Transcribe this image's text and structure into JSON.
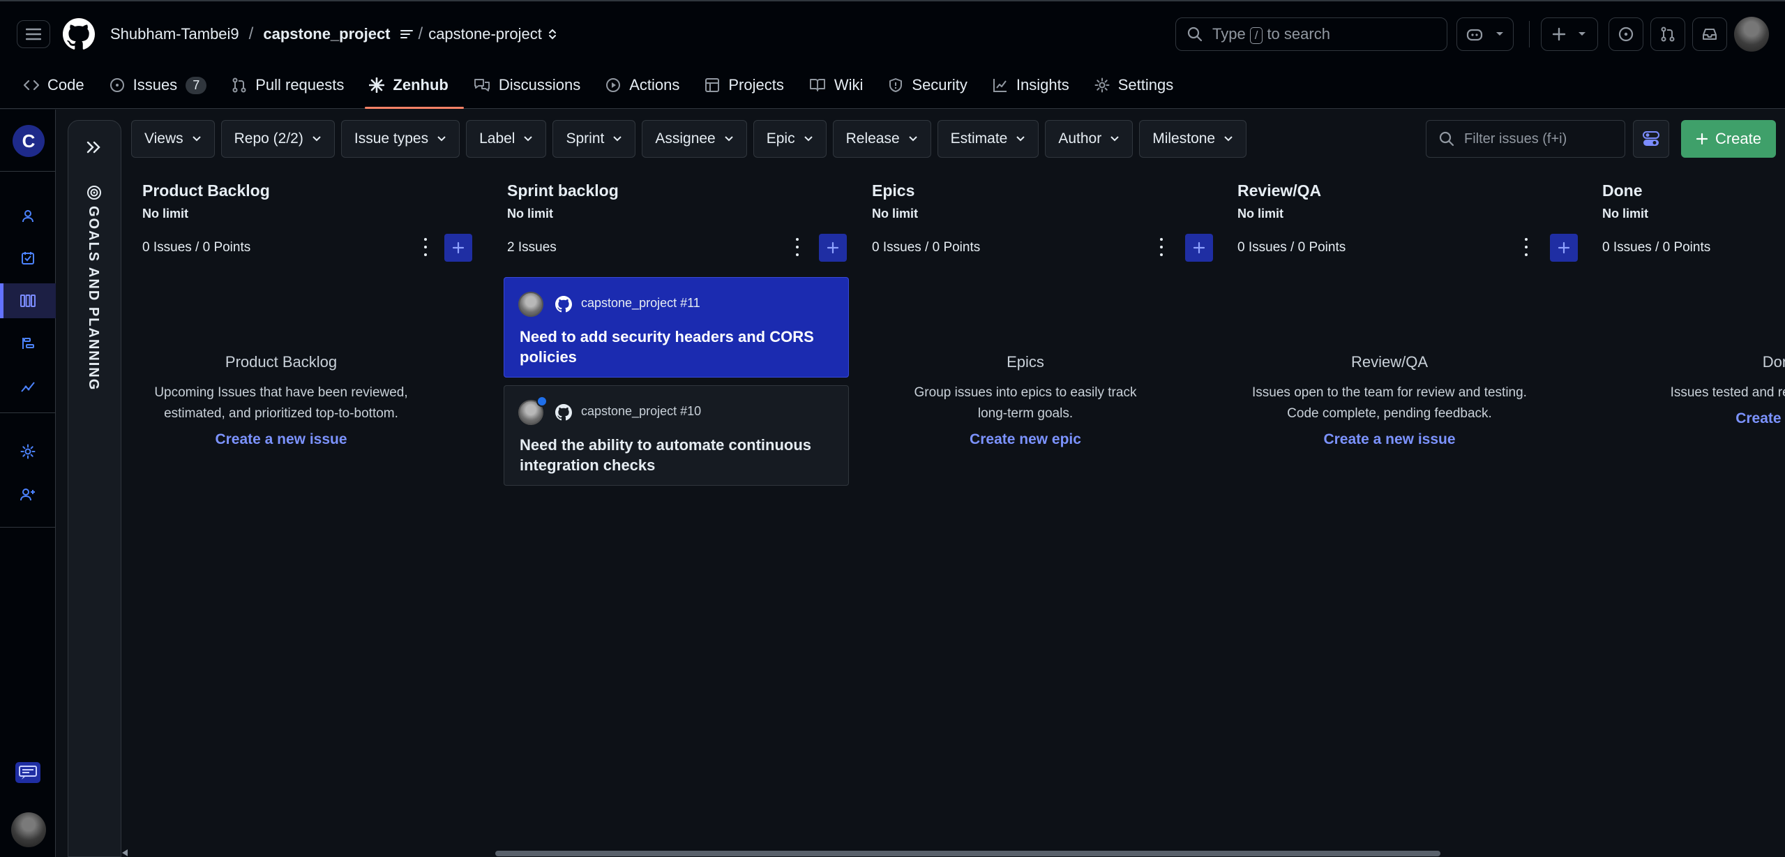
{
  "header": {
    "owner": "Shubham-Tambei9",
    "repo": "capstone_project",
    "project": "capstone-project",
    "search_prefix": "Type",
    "search_key": "/",
    "search_suffix": "to search"
  },
  "tabs": [
    {
      "label": "Code",
      "icon": "code-icon"
    },
    {
      "label": "Issues",
      "icon": "issue-opened-icon",
      "count": "7"
    },
    {
      "label": "Pull requests",
      "icon": "git-pull-request-icon"
    },
    {
      "label": "Zenhub",
      "icon": "zenhub-icon",
      "active": true
    },
    {
      "label": "Discussions",
      "icon": "comment-discussion-icon"
    },
    {
      "label": "Actions",
      "icon": "play-icon"
    },
    {
      "label": "Projects",
      "icon": "table-icon"
    },
    {
      "label": "Wiki",
      "icon": "book-icon"
    },
    {
      "label": "Security",
      "icon": "shield-icon"
    },
    {
      "label": "Insights",
      "icon": "graph-icon"
    },
    {
      "label": "Settings",
      "icon": "gear-icon"
    }
  ],
  "rail": {
    "logo_letter": "C"
  },
  "panel": {
    "title": "GOALS AND PLANNING"
  },
  "filters": [
    "Views",
    "Repo (2/2)",
    "Issue types",
    "Label",
    "Sprint",
    "Assignee",
    "Epic",
    "Release",
    "Estimate",
    "Author",
    "Milestone"
  ],
  "filter_input": {
    "placeholder": "Filter issues (f+i)"
  },
  "create_label": "Create",
  "columns": [
    {
      "title": "Product Backlog",
      "limit": "No limit",
      "count": "0 Issues / 0 Points",
      "empty_title": "Product Backlog",
      "empty_desc": "Upcoming Issues that have been reviewed, estimated, and prioritized top-to-bottom.",
      "empty_link": "Create a new issue"
    },
    {
      "title": "Sprint backlog",
      "limit": "No limit",
      "count": "2 Issues"
    },
    {
      "title": "Epics",
      "limit": "No limit",
      "count": "0 Issues / 0 Points",
      "empty_title": "Epics",
      "empty_desc": "Group issues into epics to easily track long-term goals.",
      "empty_link": "Create new epic"
    },
    {
      "title": "Review/QA",
      "limit": "No limit",
      "count": "0 Issues / 0 Points",
      "empty_title": "Review/QA",
      "empty_desc": "Issues open to the team for review and testing. Code complete, pending feedback.",
      "empty_link": "Create a new issue"
    },
    {
      "title": "Done",
      "limit": "No limit",
      "count": "0 Issues / 0 Points",
      "empty_title": "Done",
      "empty_desc": "Issues tested and ready to production",
      "empty_link": "Create a new"
    }
  ],
  "cards": [
    {
      "ref": "capstone_project #11",
      "title": "Need to add security headers and CORS policies"
    },
    {
      "ref": "capstone_project #10",
      "title": "Need the ability to automate continuous integration checks"
    }
  ]
}
